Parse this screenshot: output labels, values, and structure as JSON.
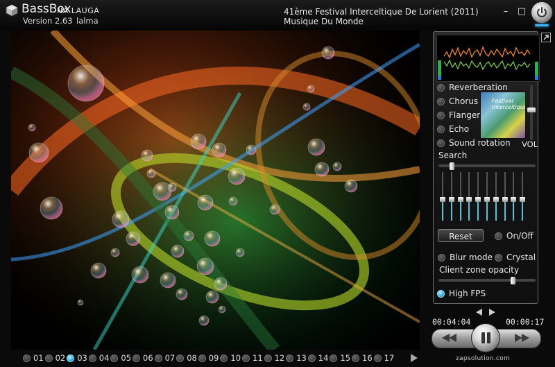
{
  "app": {
    "name": "BassBox",
    "subtitle": "NA LAUGA",
    "version": "Version 2.63",
    "user": "lalma"
  },
  "now_playing": {
    "title": "41ème Festival Interceltique De Lorient (2011)",
    "genre": "Musique Du Monde"
  },
  "window_controls": {
    "minimize": "–",
    "maximize": "□",
    "close": "✕"
  },
  "tracks": [
    "01",
    "02",
    "03",
    "04",
    "05",
    "06",
    "07",
    "08",
    "09",
    "10",
    "11",
    "12",
    "13",
    "14",
    "15",
    "16",
    "17"
  ],
  "selected_track": "03",
  "effects": {
    "reverberation": "Reverberation",
    "chorus": "Chorus",
    "flanger": "Flanger",
    "echo": "Echo",
    "sound_rotation": "Sound rotation"
  },
  "album_art": {
    "text": "Festival Interceltique"
  },
  "volume": {
    "label": "VOL",
    "level": 0.55
  },
  "search": {
    "label": "Search",
    "position": 0.12
  },
  "equalizer": {
    "bands": [
      0.42,
      0.42,
      0.42,
      0.42,
      0.42,
      0.42,
      0.42,
      0.42,
      0.42,
      0.42
    ],
    "reset_label": "Reset",
    "onoff_label": "On/Off"
  },
  "display": {
    "blur_mode": "Blur mode",
    "crystal": "Crystal",
    "opacity_label": "Client zone opacity",
    "opacity": 0.78,
    "high_fps": "High FPS"
  },
  "playback": {
    "elapsed": "00:04:04",
    "remaining": "00:00:17"
  },
  "brand": "zapsolution.com",
  "colors": {
    "accent": "#39b3e6",
    "eq_fill": "#4ec5d9"
  }
}
